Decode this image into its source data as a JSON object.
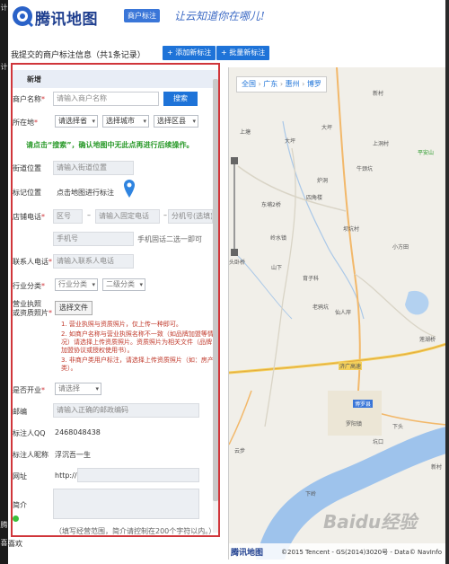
{
  "header": {
    "logo_text": "腾讯地图",
    "badge": "商户标注",
    "slogan": "让云知道你在哪儿!"
  },
  "toolbar": {
    "title": "我提交的商户标注信息（共1条记录）",
    "add_label": "+ 添加新标注",
    "batch_label": "+ 批量新标注"
  },
  "form": {
    "section_title": "新增",
    "name": {
      "label": "商户名称",
      "placeholder": "请输入商户名称",
      "search_label": "搜索"
    },
    "region": {
      "label": "所在地",
      "province": "请选择省",
      "city": "选择城市",
      "district": "选择区县"
    },
    "hint": "请点击“搜索”，确认地图中无此点再进行后续操作。",
    "street": {
      "label": "街道位置",
      "placeholder": "请输入街道位置"
    },
    "mark": {
      "label": "标记位置",
      "text": "点击地图进行标注"
    },
    "phone": {
      "label": "店铺电话",
      "area": "区号",
      "fixed": "请输入固定电话",
      "ext": "分机号(选填)",
      "mobile": "手机号",
      "note": "手机固话二选一即可"
    },
    "contact": {
      "label": "联系人电话",
      "placeholder": "请输入联系人电话"
    },
    "category": {
      "label": "行业分类",
      "first": "行业分类",
      "second": "二级分类"
    },
    "license": {
      "label1": "营业执照",
      "label2": "或资质照片",
      "button": "选择文件",
      "notes": [
        "1. 营业执照与资质照片，仅上传一种即可。",
        "2. 如商户名称与营业执照名称不一致（如品牌加盟等情况）请选择上传资质照片。资质照片为相关文件（品牌加盟协议或授权使用书）。",
        "3. 非商户类用户标注，请选择上传资质照片（如：房产类）。"
      ]
    },
    "open": {
      "label": "是否开业",
      "value": "请选择"
    },
    "postcode": {
      "label": "邮编",
      "placeholder": "请输入正确的邮政编码"
    },
    "qq": {
      "label": "标注人QQ",
      "value": "2468048438"
    },
    "nick": {
      "label": "标注人昵称",
      "value": "浮沉吾一生"
    },
    "url": {
      "label": "网址",
      "prefix": "http://"
    },
    "intro": {
      "label": "简介",
      "note": "（填写经营范围，简介请控制在200个字符以内。）"
    }
  },
  "map": {
    "breadcrumb": [
      "全国",
      "广东",
      "惠州",
      "博罗"
    ],
    "labels": [
      "上塘",
      "新村",
      "大坪",
      "大坪",
      "牛颈坑",
      "平安山",
      "上洞村",
      "炉洞",
      "四角楼",
      "东埔2桥",
      "岭水镇",
      "坝坑村",
      "小方田",
      "头卧桥",
      "山下",
      "育子科",
      "老鸦坑",
      "仙人岸",
      "莲湖桥",
      "济广高速",
      "罗阳镇",
      "博罗县",
      "下头",
      "坑口",
      "云步",
      "新村",
      "下岭"
    ],
    "logo": "腾讯地图",
    "copyright": "©2015 Tencent - GS(2014)3020号 - Data© NavInfo"
  },
  "watermark": "Baidu经验",
  "bottom_left": "喜欢"
}
